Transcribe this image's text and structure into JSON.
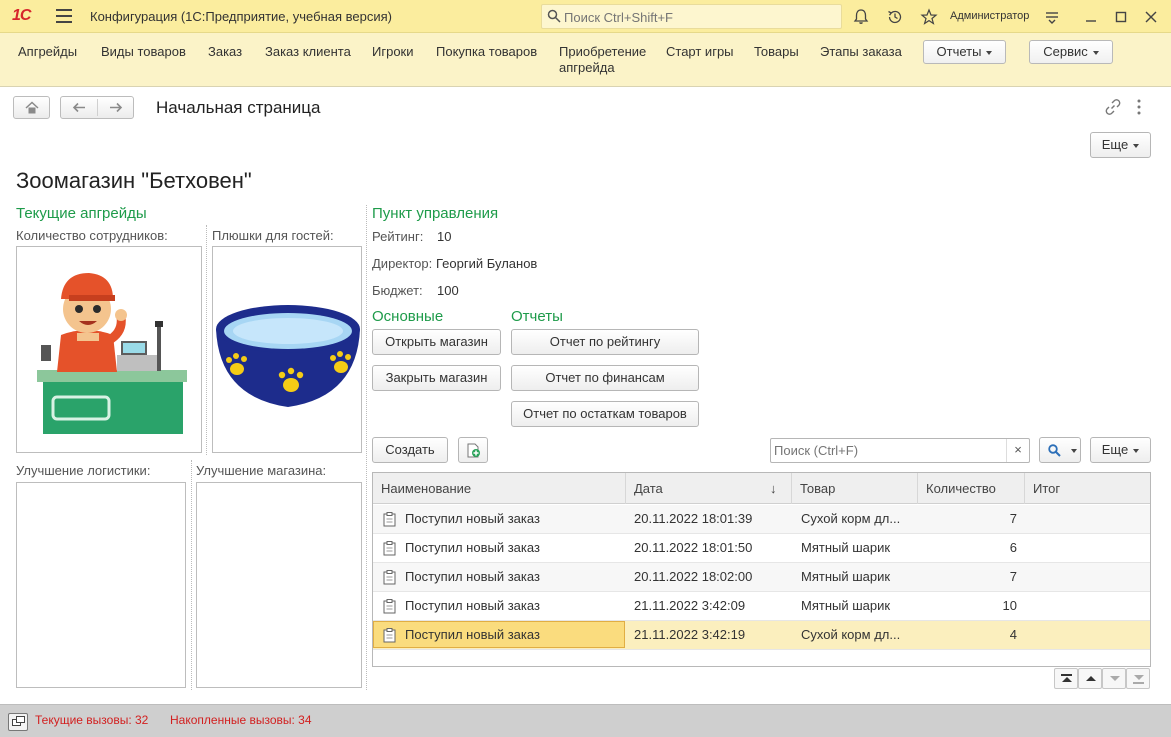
{
  "titlebar": {
    "logo": "1С",
    "title": "Конфигурация  (1С:Предприятие, учебная версия)",
    "search_placeholder": "Поиск Ctrl+Shift+F",
    "user": "Администратор"
  },
  "sections": {
    "items": [
      "Апгрейды",
      "Виды товаров",
      "Заказ",
      "Заказ клиента",
      "Игроки",
      "Покупка товаров",
      "Приобретение\nапгрейда",
      "Старт игры",
      "Товары",
      "Этапы заказа"
    ],
    "reports": "Отчеты",
    "service": "Сервис"
  },
  "page": {
    "title": "Начальная страница",
    "more": "Еще"
  },
  "shop": {
    "title": "Зоомагазин \"Бетховен\"",
    "upgrades_title": "Текущие апгрейды",
    "employees_label": "Количество сотрудников:",
    "snacks_label": "Плюшки для гостей:",
    "logistics_label": "Улучшение логистики:",
    "shop_upgrade_label": "Улучшение магазина:"
  },
  "control": {
    "title": "Пункт управления",
    "rating_label": "Рейтинг:",
    "rating_value": "10",
    "director_label": "Директор:",
    "director_value": "Георгий Буланов",
    "budget_label": "Бюджет:",
    "budget_value": "100",
    "main_title": "Основные",
    "reports_title": "Отчеты",
    "open_shop": "Открыть магазин",
    "close_shop": "Закрыть магазин",
    "report_rating": "Отчет по рейтингу",
    "report_finance": "Отчет по финансам",
    "report_stock": "Отчет по остаткам товаров"
  },
  "list": {
    "create": "Создать",
    "search_placeholder": "Поиск (Ctrl+F)",
    "clear": "×",
    "more": "Еще",
    "columns": [
      "Наименование",
      "Дата",
      "Товар",
      "Количество",
      "Итог"
    ],
    "sort_arrow": "↓",
    "rows": [
      {
        "name": "Поступил новый заказ",
        "date": "20.11.2022 18:01:39",
        "product": "Сухой корм дл...",
        "qty": "7",
        "total": ""
      },
      {
        "name": "Поступил новый заказ",
        "date": "20.11.2022 18:01:50",
        "product": "Мятный шарик",
        "qty": "6",
        "total": ""
      },
      {
        "name": "Поступил новый заказ",
        "date": "20.11.2022 18:02:00",
        "product": "Мятный шарик",
        "qty": "7",
        "total": ""
      },
      {
        "name": "Поступил новый заказ",
        "date": "21.11.2022 3:42:09",
        "product": "Мятный шарик",
        "qty": "10",
        "total": ""
      },
      {
        "name": "Поступил новый заказ",
        "date": "21.11.2022 3:42:19",
        "product": "Сухой корм дл...",
        "qty": "4",
        "total": ""
      }
    ]
  },
  "status": {
    "current_calls": "Текущие вызовы: 32",
    "accumulated_calls": "Накопленные вызовы: 34"
  },
  "colors": {
    "titlebar": "#fbed9e",
    "sections_bg": "#fbf3c8",
    "group_title": "#1e9b4a",
    "selected_row": "#fbefbe",
    "status_red": "#d21f1f"
  }
}
